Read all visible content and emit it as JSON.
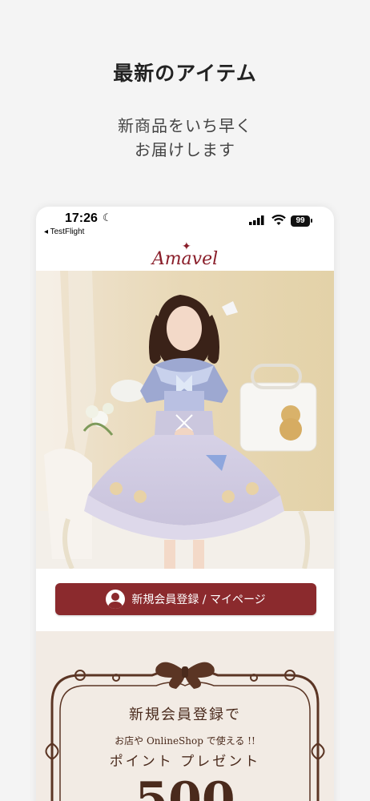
{
  "headline": "最新のアイテム",
  "subline": [
    "新商品をいち早く",
    "お届けします"
  ],
  "status": {
    "time": "17:26",
    "back_app": "◂ TestFlight",
    "battery": "99"
  },
  "brand": {
    "logo": "Amavel",
    "accent": "#8b2a2d"
  },
  "cta": {
    "label": "新規会員登録 / マイページ"
  },
  "promo": {
    "title": "新規会員登録で",
    "sub": "お店や OnlineShop で使える !!",
    "point": "ポイント プレゼント",
    "amount": "500"
  }
}
